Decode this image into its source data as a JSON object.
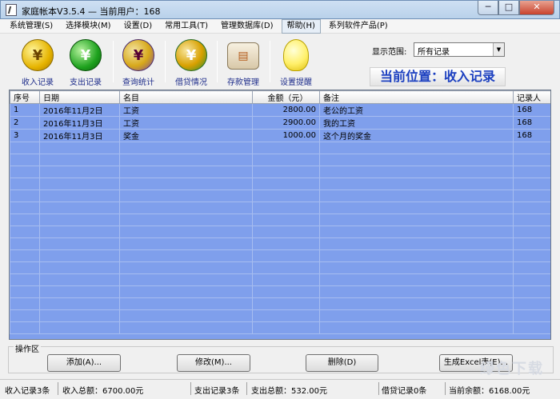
{
  "window": {
    "title": "家庭帐本V3.5.4 — 当前用户：168",
    "minimize": "─",
    "maximize": "□",
    "close": "✕"
  },
  "menu": [
    "系统管理(S)",
    "选择模块(M)",
    "设置(D)",
    "常用工具(T)",
    "管理数据库(D)",
    "帮助(H)",
    "系列软件产品(P)"
  ],
  "toolbar": [
    {
      "label": "收入记录",
      "icon": "income-coin-icon",
      "glyph": "¥"
    },
    {
      "label": "支出记录",
      "icon": "expense-coin-icon",
      "glyph": "¥"
    },
    {
      "label": "查询统计",
      "icon": "query-coin-icon",
      "glyph": "¥"
    },
    {
      "label": "借贷情况",
      "icon": "loan-cycle-icon",
      "glyph": "¥"
    },
    {
      "label": "存款管理",
      "icon": "deposit-box-icon",
      "glyph": "▤"
    },
    {
      "label": "设置提醒",
      "icon": "reminder-bulb-icon",
      "glyph": ""
    }
  ],
  "range": {
    "label": "显示范围:",
    "selected": "所有记录"
  },
  "location": "当前位置：收入记录",
  "table": {
    "headers": [
      "序号",
      "日期",
      "名目",
      "金额（元）",
      "备注",
      "记录人"
    ],
    "rows": [
      [
        "1",
        "2016年11月2日",
        "工资",
        "2800.00",
        "老公的工资",
        "168"
      ],
      [
        "2",
        "2016年11月3日",
        "工资",
        "2900.00",
        "我的工资",
        "168"
      ],
      [
        "3",
        "2016年11月3日",
        "奖金",
        "1000.00",
        "这个月的奖金",
        "168"
      ]
    ]
  },
  "ops": {
    "title": "操作区",
    "add": "添加(A)...",
    "edit": "修改(M)...",
    "delete": "删除(D)",
    "excel": "生成Excel表(E)..."
  },
  "status": {
    "income_count": "收入记录3条",
    "income_total": "收入总额：6700.00元",
    "expense_count": "支出记录3条",
    "expense_total": "支出总额：532.00元",
    "loan_count": "借贷记录0条",
    "balance": "当前余额：6168.00元"
  },
  "watermark": "绿色下载"
}
